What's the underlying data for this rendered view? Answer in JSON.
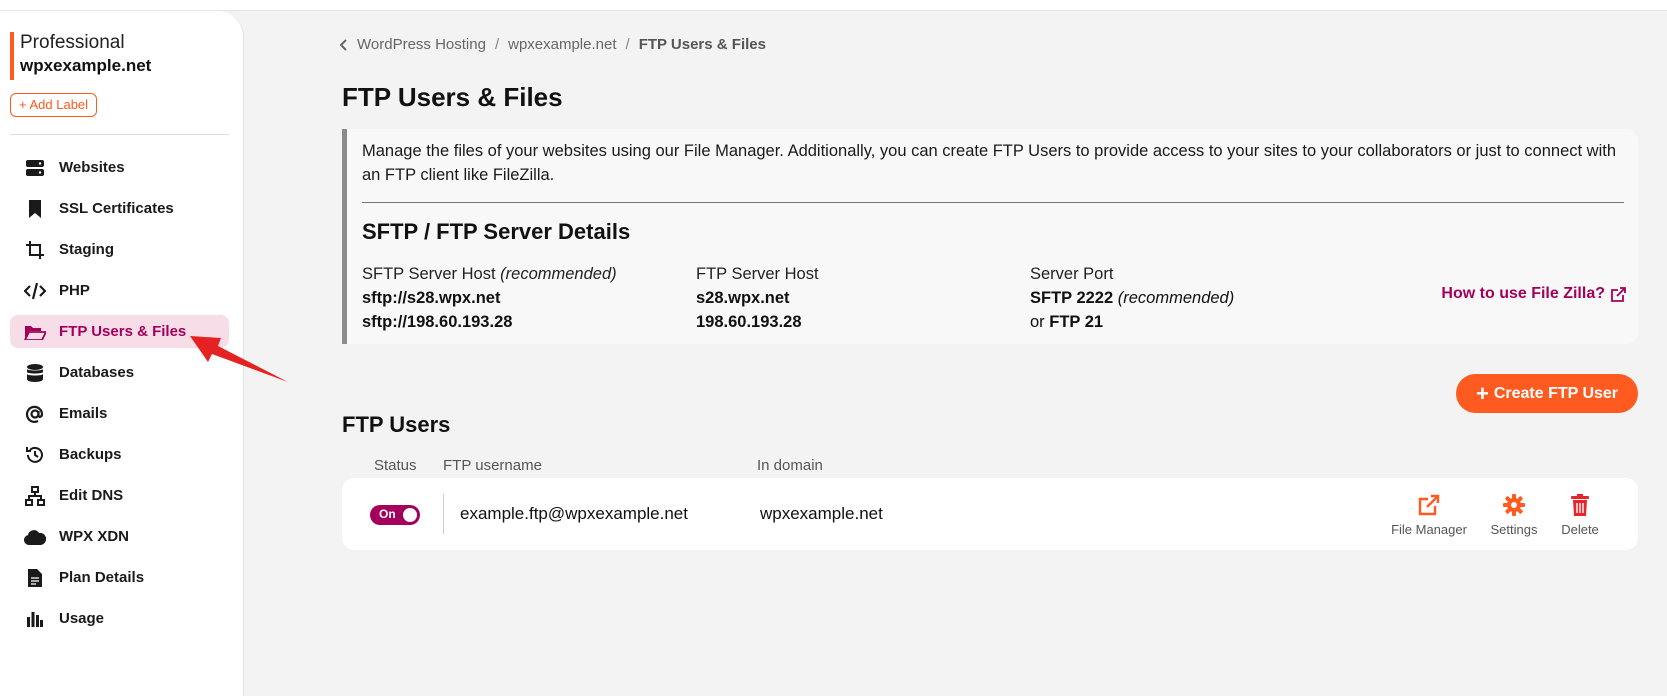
{
  "sidebar": {
    "plan_name": "Professional",
    "domain": "wpxexample.net",
    "add_label": "+ Add Label",
    "items": [
      {
        "label": "Websites",
        "icon": "server-icon"
      },
      {
        "label": "SSL Certificates",
        "icon": "bookmark-icon"
      },
      {
        "label": "Staging",
        "icon": "staging-icon"
      },
      {
        "label": "PHP",
        "icon": "code-icon"
      },
      {
        "label": "FTP Users & Files",
        "icon": "folder-open-icon",
        "active": true
      },
      {
        "label": "Databases",
        "icon": "database-icon"
      },
      {
        "label": "Emails",
        "icon": "at-icon"
      },
      {
        "label": "Backups",
        "icon": "history-icon"
      },
      {
        "label": "Edit DNS",
        "icon": "network-icon"
      },
      {
        "label": "WPX XDN",
        "icon": "cloud-icon"
      },
      {
        "label": "Plan Details",
        "icon": "document-icon"
      },
      {
        "label": "Usage",
        "icon": "bar-chart-icon"
      }
    ]
  },
  "breadcrumb": [
    "WordPress Hosting",
    "wpxexample.net",
    "FTP Users & Files"
  ],
  "page_title": "FTP Users & Files",
  "info": {
    "description": "Manage the files of your websites using our File Manager. Additionally, you can create FTP Users to provide access to your sites to your collaborators or just to connect with an FTP client like FileZilla.",
    "heading": "SFTP / FTP Server Details",
    "sftp_host_label": "SFTP Server Host",
    "sftp_host_note": "(recommended)",
    "sftp_host_1": "sftp://s28.wpx.net",
    "sftp_host_2": "sftp://198.60.193.28",
    "ftp_host_label": "FTP Server Host",
    "ftp_host_1": "s28.wpx.net",
    "ftp_host_2": "198.60.193.28",
    "port_label": "Server Port",
    "port_sftp": "SFTP 2222",
    "port_sftp_note": "(recommended)",
    "port_or": "or",
    "port_ftp": "FTP 21",
    "howto_link": "How to use File Zilla?"
  },
  "create_button": "Create FTP User",
  "ftp_users": {
    "title": "FTP Users",
    "columns": [
      "Status",
      "FTP username",
      "In domain"
    ],
    "rows": [
      {
        "status": "On",
        "username": "example.ftp@wpxexample.net",
        "domain": "wpxexample.net"
      }
    ],
    "actions": [
      "File Manager",
      "Settings",
      "Delete"
    ]
  },
  "colors": {
    "accent": "#ff5a1f",
    "brand": "#a4005b"
  }
}
